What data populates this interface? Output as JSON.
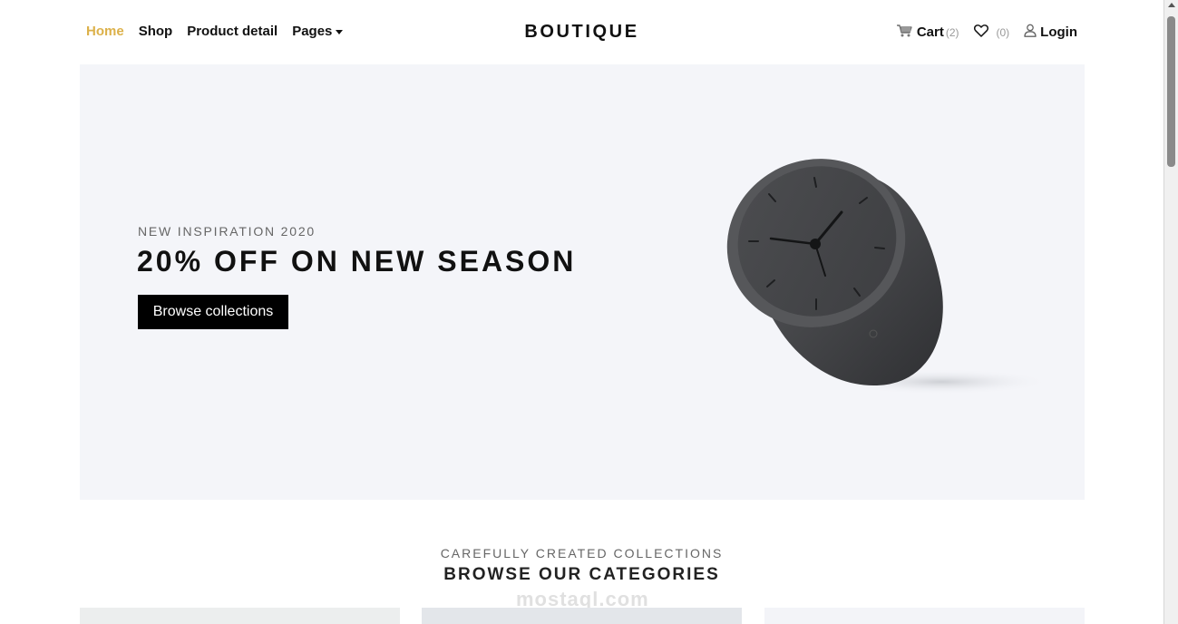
{
  "navbar": {
    "links": [
      {
        "label": "Home",
        "active": true
      },
      {
        "label": "Shop"
      },
      {
        "label": "Product detail"
      },
      {
        "label": "Pages"
      }
    ],
    "brand": "BOUTIQUE",
    "cart": {
      "label": "Cart",
      "count": "(2)",
      "icon": "cart-icon"
    },
    "wishlist": {
      "count": "(0)",
      "icon": "heart-icon"
    },
    "login": {
      "label": "Login",
      "icon": "user-icon"
    }
  },
  "hero": {
    "subtitle": "NEW INSPIRATION 2020",
    "title": "20% OFF ON NEW SEASON",
    "button": "Browse collections"
  },
  "categories": {
    "subtitle": "CAREFULLY CREATED COLLECTIONS",
    "title": "BROWSE OUR CATEGORIES"
  },
  "watermark": "mostaql.com",
  "colors": {
    "accent": "#dcb14a",
    "hero_bg": "#f4f5f9",
    "button_bg": "#000000"
  }
}
